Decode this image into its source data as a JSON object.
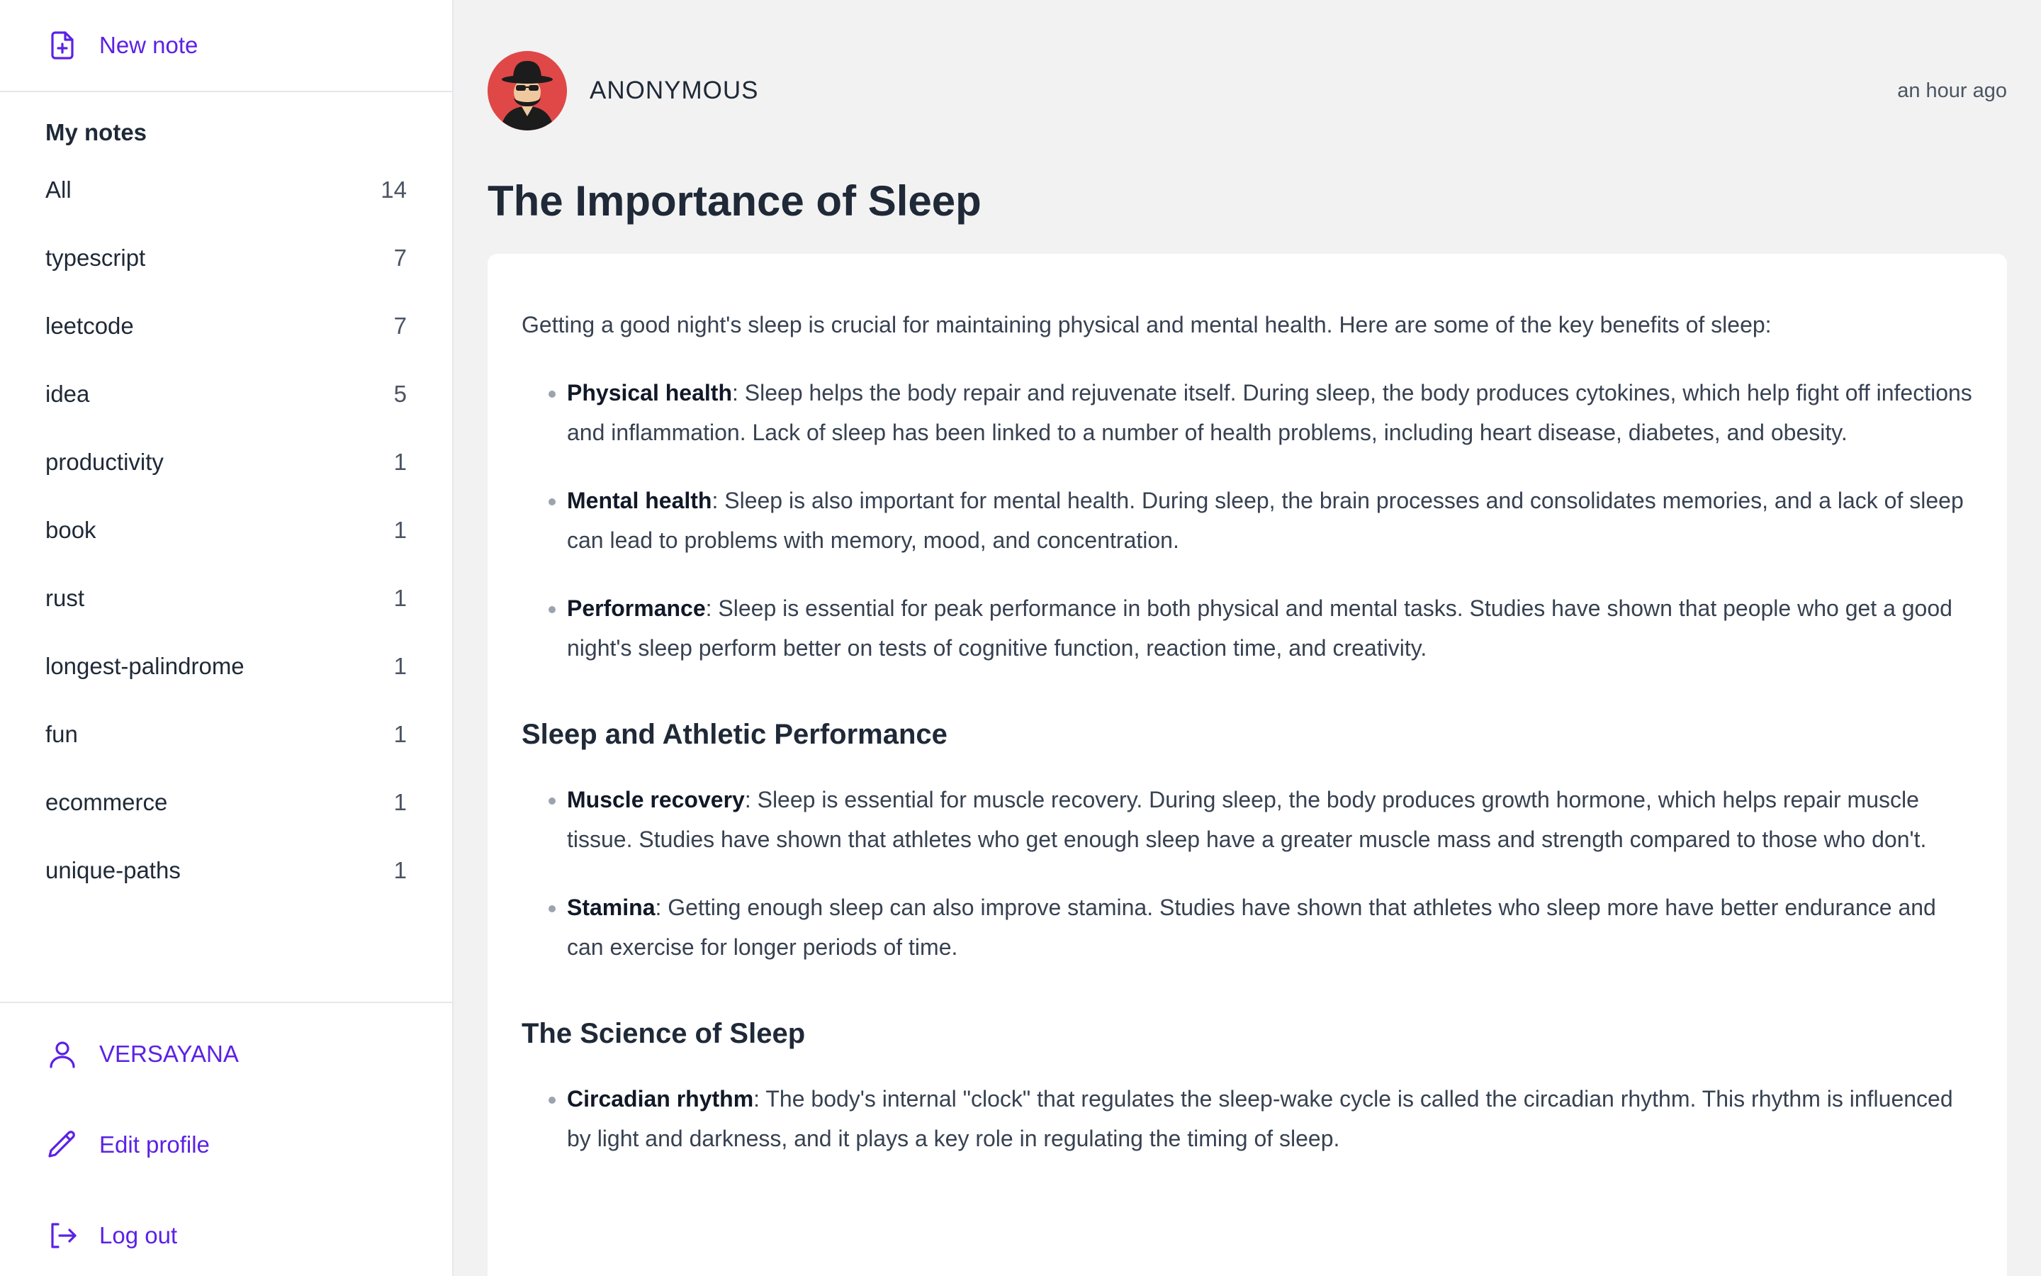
{
  "sidebar": {
    "new_note_label": "New note",
    "section_title": "My notes",
    "tags": [
      {
        "label": "All",
        "count": "14"
      },
      {
        "label": "typescript",
        "count": "7"
      },
      {
        "label": "leetcode",
        "count": "7"
      },
      {
        "label": "idea",
        "count": "5"
      },
      {
        "label": "productivity",
        "count": "1"
      },
      {
        "label": "book",
        "count": "1"
      },
      {
        "label": "rust",
        "count": "1"
      },
      {
        "label": "longest-palindrome",
        "count": "1"
      },
      {
        "label": "fun",
        "count": "1"
      },
      {
        "label": "ecommerce",
        "count": "1"
      },
      {
        "label": "unique-paths",
        "count": "1"
      }
    ],
    "username": "VERSAYANA",
    "edit_profile_label": "Edit profile",
    "logout_label": "Log out"
  },
  "note": {
    "author": "ANONYMOUS",
    "timestamp": "an hour ago",
    "title": "The Importance of Sleep",
    "intro": "Getting a good night's sleep is crucial for maintaining physical and mental health. Here are some of the key benefits of sleep:",
    "benefits": [
      {
        "term": "Physical health",
        "text": ": Sleep helps the body repair and rejuvenate itself. During sleep, the body produces cytokines, which help fight off infections and inflammation. Lack of sleep has been linked to a number of health problems, including heart disease, diabetes, and obesity."
      },
      {
        "term": "Mental health",
        "text": ": Sleep is also important for mental health. During sleep, the brain processes and consolidates memories, and a lack of sleep can lead to problems with memory, mood, and concentration."
      },
      {
        "term": "Performance",
        "text": ": Sleep is essential for peak performance in both physical and mental tasks. Studies have shown that people who get a good night's sleep perform better on tests of cognitive function, reaction time, and creativity."
      }
    ],
    "section2_heading": "Sleep and Athletic Performance",
    "athletic": [
      {
        "term": "Muscle recovery",
        "text": ": Sleep is essential for muscle recovery. During sleep, the body produces growth hormone, which helps repair muscle tissue. Studies have shown that athletes who get enough sleep have a greater muscle mass and strength compared to those who don't."
      },
      {
        "term": "Stamina",
        "text": ": Getting enough sleep can also improve stamina. Studies have shown that athletes who sleep more have better endurance and can exercise for longer periods of time."
      }
    ],
    "section3_heading": "The Science of Sleep",
    "science": [
      {
        "term": "Circadian rhythm",
        "text": ": The body's internal \"clock\" that regulates the sleep-wake cycle is called the circadian rhythm. This rhythm is influenced by light and darkness, and it plays a key role in regulating the timing of sleep."
      }
    ]
  },
  "colors": {
    "accent": "#5b21e6",
    "avatar_bg": "#e04848",
    "page_bg": "#f2f2f2"
  },
  "icons": {
    "new_note": "file-plus-icon",
    "user": "user-icon",
    "edit": "pencil-icon",
    "logout": "logout-icon"
  }
}
